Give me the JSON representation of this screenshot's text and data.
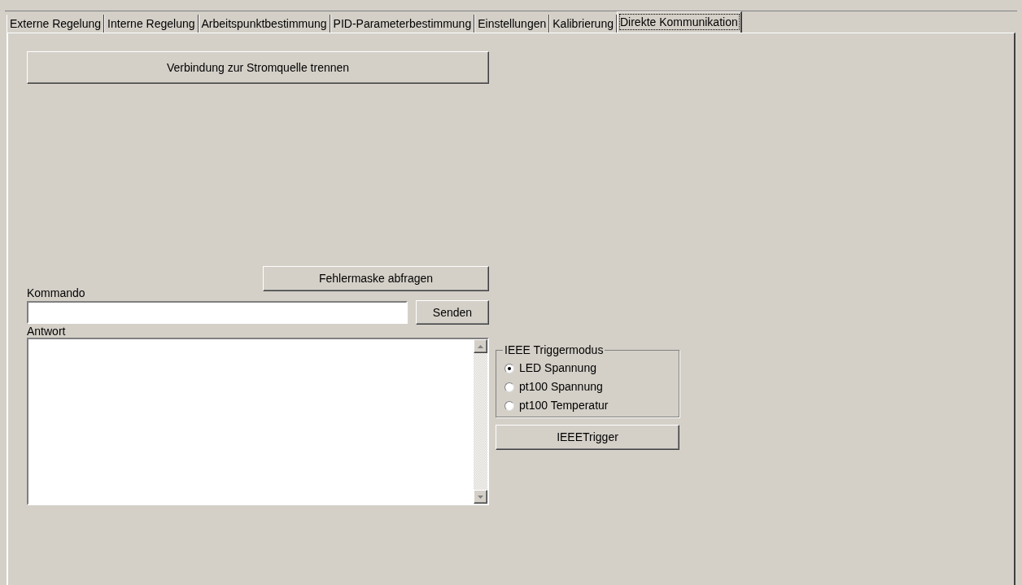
{
  "tabs": [
    {
      "label": "Externe Regelung",
      "selected": false
    },
    {
      "label": "Interne Regelung",
      "selected": false
    },
    {
      "label": "Arbeitspunktbestimmung",
      "selected": false
    },
    {
      "label": "PID-Parameterbestimmung",
      "selected": false
    },
    {
      "label": "Einstellungen",
      "selected": false
    },
    {
      "label": "Kalibrierung",
      "selected": false
    },
    {
      "label": "Direkte Kommunikation",
      "selected": true
    }
  ],
  "disconnect_button": "Verbindung zur Stromquelle trennen",
  "error_mask_button": "Fehlermaske abfragen",
  "command": {
    "label": "Kommando",
    "send_button": "Senden"
  },
  "response": {
    "label": "Antwort"
  },
  "trigger_mode": {
    "title": "IEEE Triggermodus",
    "options": [
      {
        "label": "LED Spannung",
        "selected": true
      },
      {
        "label": "pt100 Spannung",
        "selected": false
      },
      {
        "label": "pt100 Temperatur",
        "selected": false
      }
    ]
  },
  "trigger_button": "IEEETrigger"
}
